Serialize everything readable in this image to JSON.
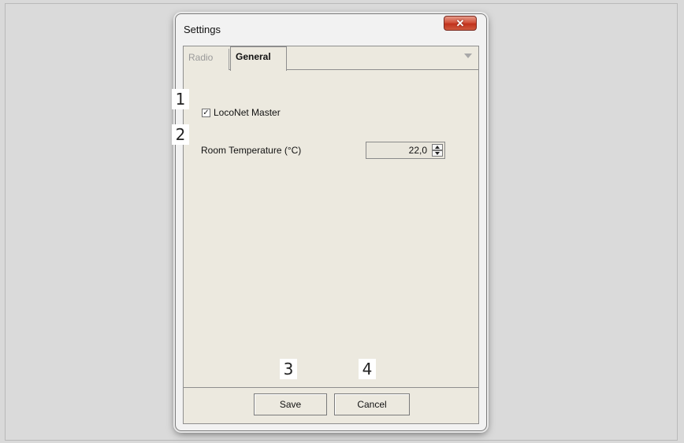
{
  "window": {
    "title": "Settings",
    "close_icon": "close-icon",
    "close_glyph": "✕"
  },
  "tabs": [
    {
      "label": "Radio",
      "selected": false
    },
    {
      "label": "General",
      "selected": true
    }
  ],
  "general": {
    "loconet_master": {
      "label": "LocoNet Master",
      "checked": true,
      "check_glyph": "✓"
    },
    "room_temperature": {
      "label": "Room Temperature (°C)",
      "value": "22,0"
    }
  },
  "callouts": [
    "1",
    "2",
    "3",
    "4"
  ],
  "buttons": {
    "save_label": "Save",
    "cancel_label": "Cancel"
  },
  "colors": {
    "close_button": "#c1321c",
    "panel_background": "#ece9df",
    "page_background": "#d9d9d9"
  }
}
